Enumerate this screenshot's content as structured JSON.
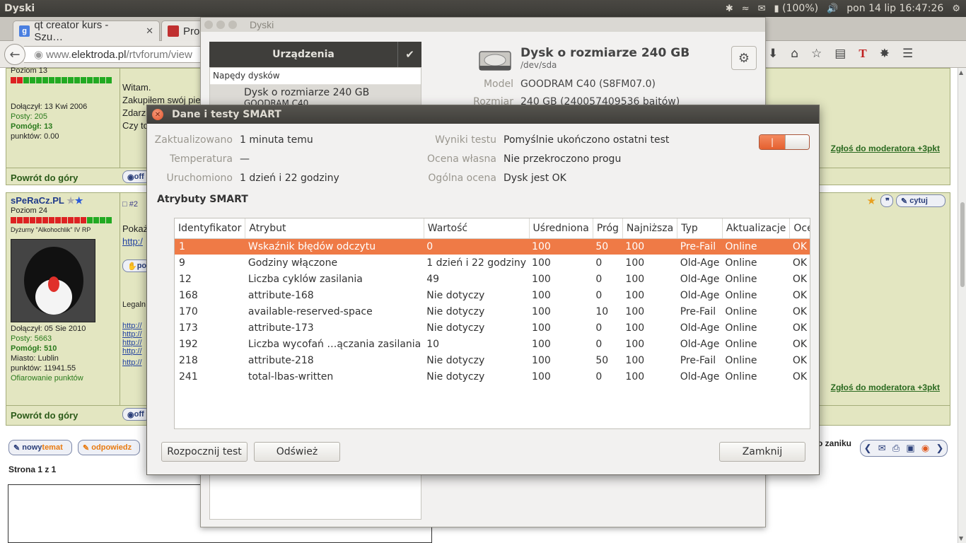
{
  "panel": {
    "app_title": "Dyski",
    "battery": "(100%)",
    "datetime": "pon 14 lip 16:47:26"
  },
  "browser": {
    "tabs": [
      {
        "label": "qt creator kurs - Szu…",
        "favicon": "g"
      },
      {
        "label": "Pro",
        "favicon": ""
      }
    ],
    "url_prefix": "www.",
    "url_domain": "elektroda.pl",
    "url_path": "/rtvforum/view"
  },
  "forum": {
    "post1": {
      "rank": "Poziom 13",
      "joined_label": "Dołączył:",
      "joined": "13 Kwi 2006",
      "posts_label": "Posty:",
      "posts": "205",
      "helped_label": "Pomógł:",
      "helped": "13",
      "points_label": "punktów:",
      "points": "0.00",
      "text_lines": [
        "Witam.",
        "Zakupiłem swój pie",
        "Zdarz",
        "Czy to"
      ],
      "back_to_top": "Powrót do góry",
      "report": "Zgłoś do moderatora +3pkt",
      "offline": "off"
    },
    "post2": {
      "username": "sPeRaCz.PL",
      "rank": "Poziom 24",
      "subtitle": "Dyżurny \"Alkohochlik\" IV RP",
      "post_num": "#2",
      "joined_label": "Dołączył:",
      "joined": "05 Sie 2010",
      "posts_label": "Posty:",
      "posts": "5663",
      "helped_label": "Pomógł:",
      "helped": "510",
      "city_label": "Miasto:",
      "city": "Lublin",
      "points_label": "punktów:",
      "points": "11941.55",
      "give_points": "Ofiarowanie punktów",
      "text_lines": [
        "Pokaż",
        "http:/"
      ],
      "legal": "Legaln",
      "links": [
        "http://",
        "http://",
        "http://",
        "http://",
        "http://"
      ],
      "back_to_top": "Powrót do góry",
      "report": "Zgłoś do moderatora +3pkt",
      "quote": "cytuj",
      "offline": "off",
      "po": "po"
    },
    "new_topic_prefix": "nowy",
    "new_topic_word": "temat",
    "reply": "odpowiedz",
    "page_info": "Strona 1 z 1",
    "zaniku": "o zaniku"
  },
  "disks": {
    "title": "Dyski",
    "devices_header": "Urządzenia",
    "section": "Napędy dysków",
    "device_name": "Dysk o rozmiarze 240 GB",
    "device_model": "GOODRAM C40",
    "disk_name": "Dysk o rozmiarze 240 GB",
    "disk_path": "/dev/sda",
    "model_label": "Model",
    "model_value": "GOODRAM C40 (S8FM07.0)",
    "size_label": "Rozmiar",
    "size_value": "240 GB (240057409536 bajtów)"
  },
  "smart": {
    "title": "Dane i testy SMART",
    "left": [
      {
        "k": "Zaktualizowano",
        "v": "1 minuta temu"
      },
      {
        "k": "Temperatura",
        "v": "—"
      },
      {
        "k": "Uruchomiono",
        "v": "1 dzień i 22 godziny"
      }
    ],
    "right": [
      {
        "k": "Wyniki testu",
        "v": "Pomyślnie ukończono ostatni test"
      },
      {
        "k": "Ocena własna",
        "v": "Nie przekroczono progu"
      },
      {
        "k": "Ogólna ocena",
        "v": "Dysk jest OK"
      }
    ],
    "toggle_on": "|",
    "attributes_heading": "Atrybuty SMART",
    "columns": [
      "Identyfikator",
      "Atrybut",
      "Wartość",
      "Uśredniona",
      "Próg",
      "Najniższa",
      "Typ",
      "Aktualizacje",
      "Ocena"
    ],
    "rows": [
      [
        "1",
        "Wskaźnik błędów odczytu",
        "0",
        "100",
        "50",
        "100",
        "Pre-Fail",
        "Online",
        "OK"
      ],
      [
        "9",
        "Godziny włączone",
        "1 dzień i 22 godziny",
        "100",
        "0",
        "100",
        "Old-Age",
        "Online",
        "OK"
      ],
      [
        "12",
        "Liczba cyklów zasilania",
        "49",
        "100",
        "0",
        "100",
        "Old-Age",
        "Online",
        "OK"
      ],
      [
        "168",
        "attribute-168",
        "Nie dotyczy",
        "100",
        "0",
        "100",
        "Old-Age",
        "Online",
        "OK"
      ],
      [
        "170",
        "available-reserved-space",
        "Nie dotyczy",
        "100",
        "10",
        "100",
        "Pre-Fail",
        "Online",
        "OK"
      ],
      [
        "173",
        "attribute-173",
        "Nie dotyczy",
        "100",
        "0",
        "100",
        "Old-Age",
        "Online",
        "OK"
      ],
      [
        "192",
        "Liczba wycofań …ączania zasilania",
        "10",
        "100",
        "0",
        "100",
        "Old-Age",
        "Online",
        "OK"
      ],
      [
        "218",
        "attribute-218",
        "Nie dotyczy",
        "100",
        "50",
        "100",
        "Pre-Fail",
        "Online",
        "OK"
      ],
      [
        "241",
        "total-lbas-written",
        "Nie dotyczy",
        "100",
        "0",
        "100",
        "Old-Age",
        "Online",
        "OK"
      ]
    ],
    "selected_row": 0,
    "start_test": "Rozpocznij test",
    "refresh": "Odśwież",
    "close": "Zamknij"
  },
  "colors": {
    "selection": "#ef7a46",
    "panel": "#3c3b37",
    "forum_bg": "#e3e6c1"
  }
}
